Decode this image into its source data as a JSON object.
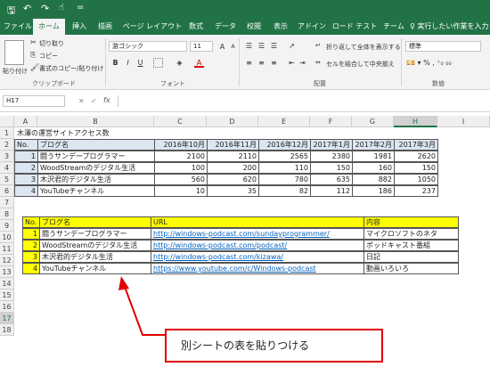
{
  "window": {
    "quickaccess_more": "="
  },
  "tabs": [
    "ファイル",
    "ホーム",
    "挿入",
    "描画",
    "ページ レイアウト",
    "数式",
    "データ",
    "校閲",
    "表示",
    "アドイン",
    "ロード テスト",
    "チーム"
  ],
  "tell_me": "実行したい作業を入力",
  "clipboard": {
    "paste": "貼り付け",
    "cut": "切り取り",
    "copy": "コピー",
    "format_painter": "書式のコピー/貼り付け",
    "label": "クリップボード"
  },
  "font": {
    "name": "游ゴシック",
    "size": "11",
    "label": "フォント",
    "bold": "B",
    "italic": "I",
    "underline": "U",
    "grow": "A",
    "shrink": "A",
    "color_letter": "A"
  },
  "alignment": {
    "wrap": "折り返して全体を表示する",
    "merge": "セルを結合して中央揃え",
    "label": "配置"
  },
  "number": {
    "format": "標準",
    "label": "数値"
  },
  "formula_bar": {
    "name_box": "H17",
    "fx": "fx",
    "value": ""
  },
  "columns": [
    "A",
    "B",
    "C",
    "D",
    "E",
    "F",
    "G",
    "H",
    "I"
  ],
  "rows": [
    "1",
    "2",
    "3",
    "4",
    "5",
    "6",
    "7",
    "8",
    "9",
    "10",
    "11",
    "12",
    "13",
    "14",
    "15",
    "16",
    "17",
    "18"
  ],
  "sheet": {
    "title": "木澤の運営サイトアクセス数",
    "table1": {
      "headers": [
        "No.",
        "ブログ名",
        "2016年10月",
        "2016年11月",
        "2016年12月",
        "2017年1月",
        "2017年2月",
        "2017年3月"
      ],
      "rows": [
        [
          "1",
          "闘うサンデープログラマー",
          "2100",
          "2110",
          "2565",
          "2380",
          "1981",
          "2620"
        ],
        [
          "2",
          "WoodStreamのデジタル生活",
          "100",
          "200",
          "110",
          "150",
          "160",
          "150"
        ],
        [
          "3",
          "木沢君的デジタル生活",
          "560",
          "620",
          "780",
          "635",
          "882",
          "1050"
        ],
        [
          "4",
          "YouTubeチャンネル",
          "10",
          "35",
          "82",
          "112",
          "186",
          "237"
        ]
      ]
    },
    "table2": {
      "headers": [
        "No.",
        "ブログ名",
        "URL",
        "内容"
      ],
      "rows": [
        [
          "1",
          "闘うサンデープログラマー",
          "http://windows-podcast.com/sundayprogrammer/",
          "マイクロソフトのネタ"
        ],
        [
          "2",
          "WoodStreamのデジタル生活",
          "http://windows-podcast.com/podcast/",
          "ポッドキャスト番組"
        ],
        [
          "3",
          "木沢君的デジタル生活",
          "http://windows-podcast.com/kizawa/",
          "日記"
        ],
        [
          "4",
          "YouTubeチャンネル",
          "https://www.youtube.com/c/Windows-podcast",
          "動画いろいろ"
        ]
      ]
    }
  },
  "annotation": "別シートの表を貼りつける",
  "colors": {
    "excel_green": "#217346",
    "header_blue": "#dce6f1",
    "yellow": "#ffff00",
    "callout_red": "#e00000",
    "link": "#0563c1"
  }
}
